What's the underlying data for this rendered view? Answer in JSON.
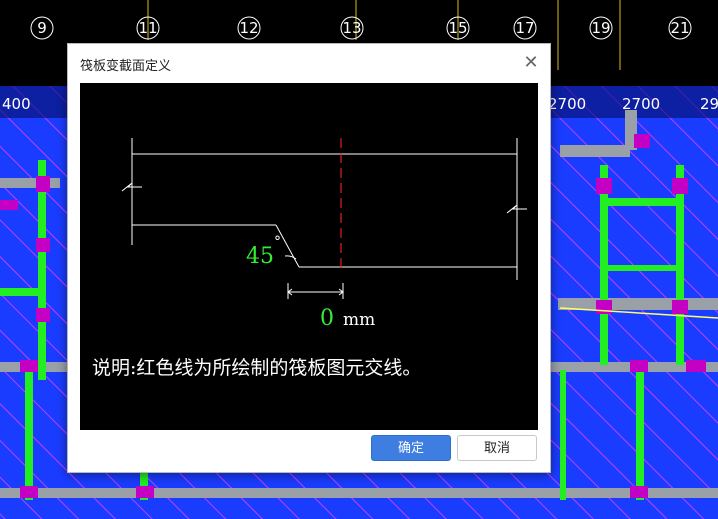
{
  "background": {
    "axis_labels": [
      "9",
      "11",
      "12",
      "13",
      "15",
      "17",
      "19",
      "21"
    ],
    "dimension_labels": [
      "400",
      "2700",
      "2700",
      "29"
    ]
  },
  "dialog": {
    "title": "筏板变截面定义",
    "close_glyph": "✕",
    "diagram": {
      "angle_value": "45",
      "degree_symbol": "°",
      "width_value": "0",
      "unit": "mm",
      "note": "说明:红色线为所绘制的筏板图元交线。"
    },
    "ok_label": "确定",
    "cancel_label": "取消"
  },
  "colors": {
    "accent_green": "#33ee33",
    "red_line": "#e02020",
    "canvas_bg": "#000000",
    "cad_blue": "#1a3cff",
    "cad_magenta": "#c000c0",
    "primary_button": "#3d7ee0"
  }
}
